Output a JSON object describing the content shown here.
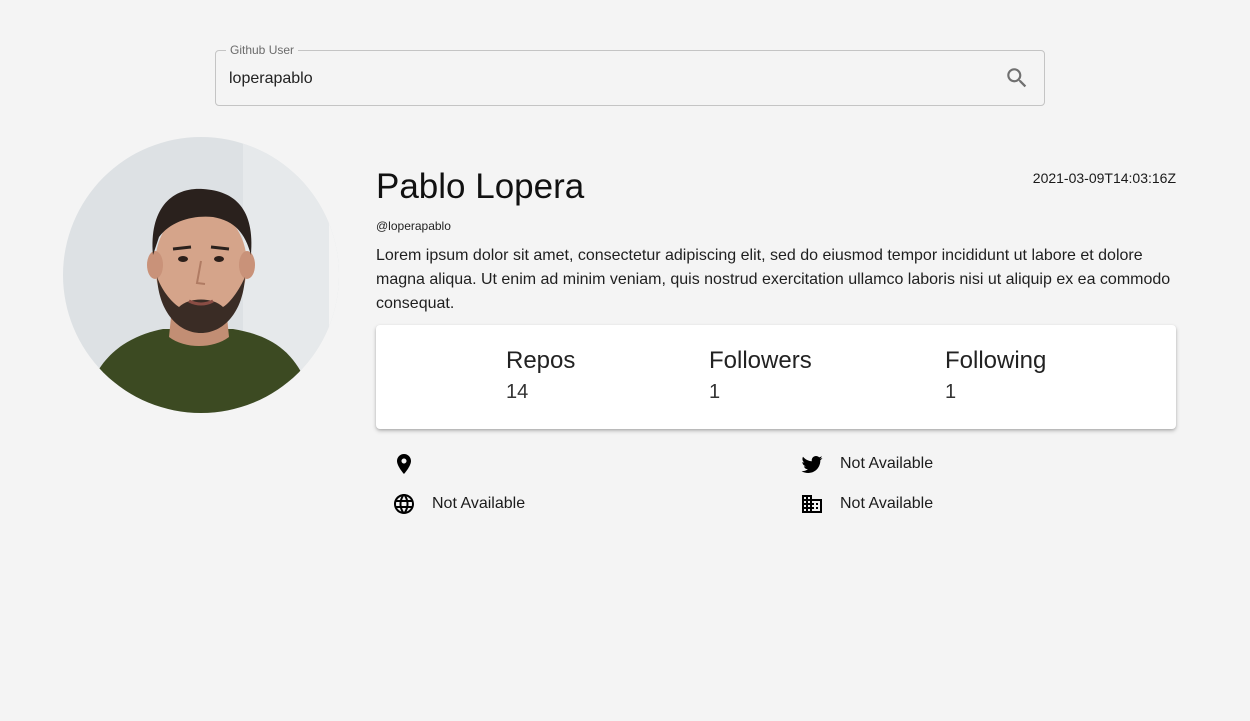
{
  "search": {
    "label": "Github User",
    "value": "loperapablo",
    "icon": "search-icon"
  },
  "profile": {
    "name": "Pablo Lopera",
    "login": "@loperapablo",
    "created_at": "2021-03-09T14:03:16Z",
    "bio": "Lorem ipsum dolor sit amet, consectetur adipiscing elit, sed do eiusmod tempor incididunt ut labore et dolore magna aliqua. Ut enim ad minim veniam, quis nostrud exercitation ullamco laboris nisi ut aliquip ex ea commodo consequat.",
    "avatar_icon": "avatar-photo"
  },
  "stats": [
    {
      "label": "Repos",
      "value": "14"
    },
    {
      "label": "Followers",
      "value": "1"
    },
    {
      "label": "Following",
      "value": "1"
    }
  ],
  "info": {
    "location": {
      "icon": "location-pin-icon",
      "text": ""
    },
    "blog": {
      "icon": "globe-icon",
      "text": "Not Available"
    },
    "twitter": {
      "icon": "twitter-icon",
      "text": "Not Available"
    },
    "company": {
      "icon": "building-icon",
      "text": "Not Available"
    }
  },
  "colors": {
    "background": "#f4f4f4",
    "card": "#ffffff",
    "border": "#c4c4c4",
    "text": "#1c1c1c"
  }
}
